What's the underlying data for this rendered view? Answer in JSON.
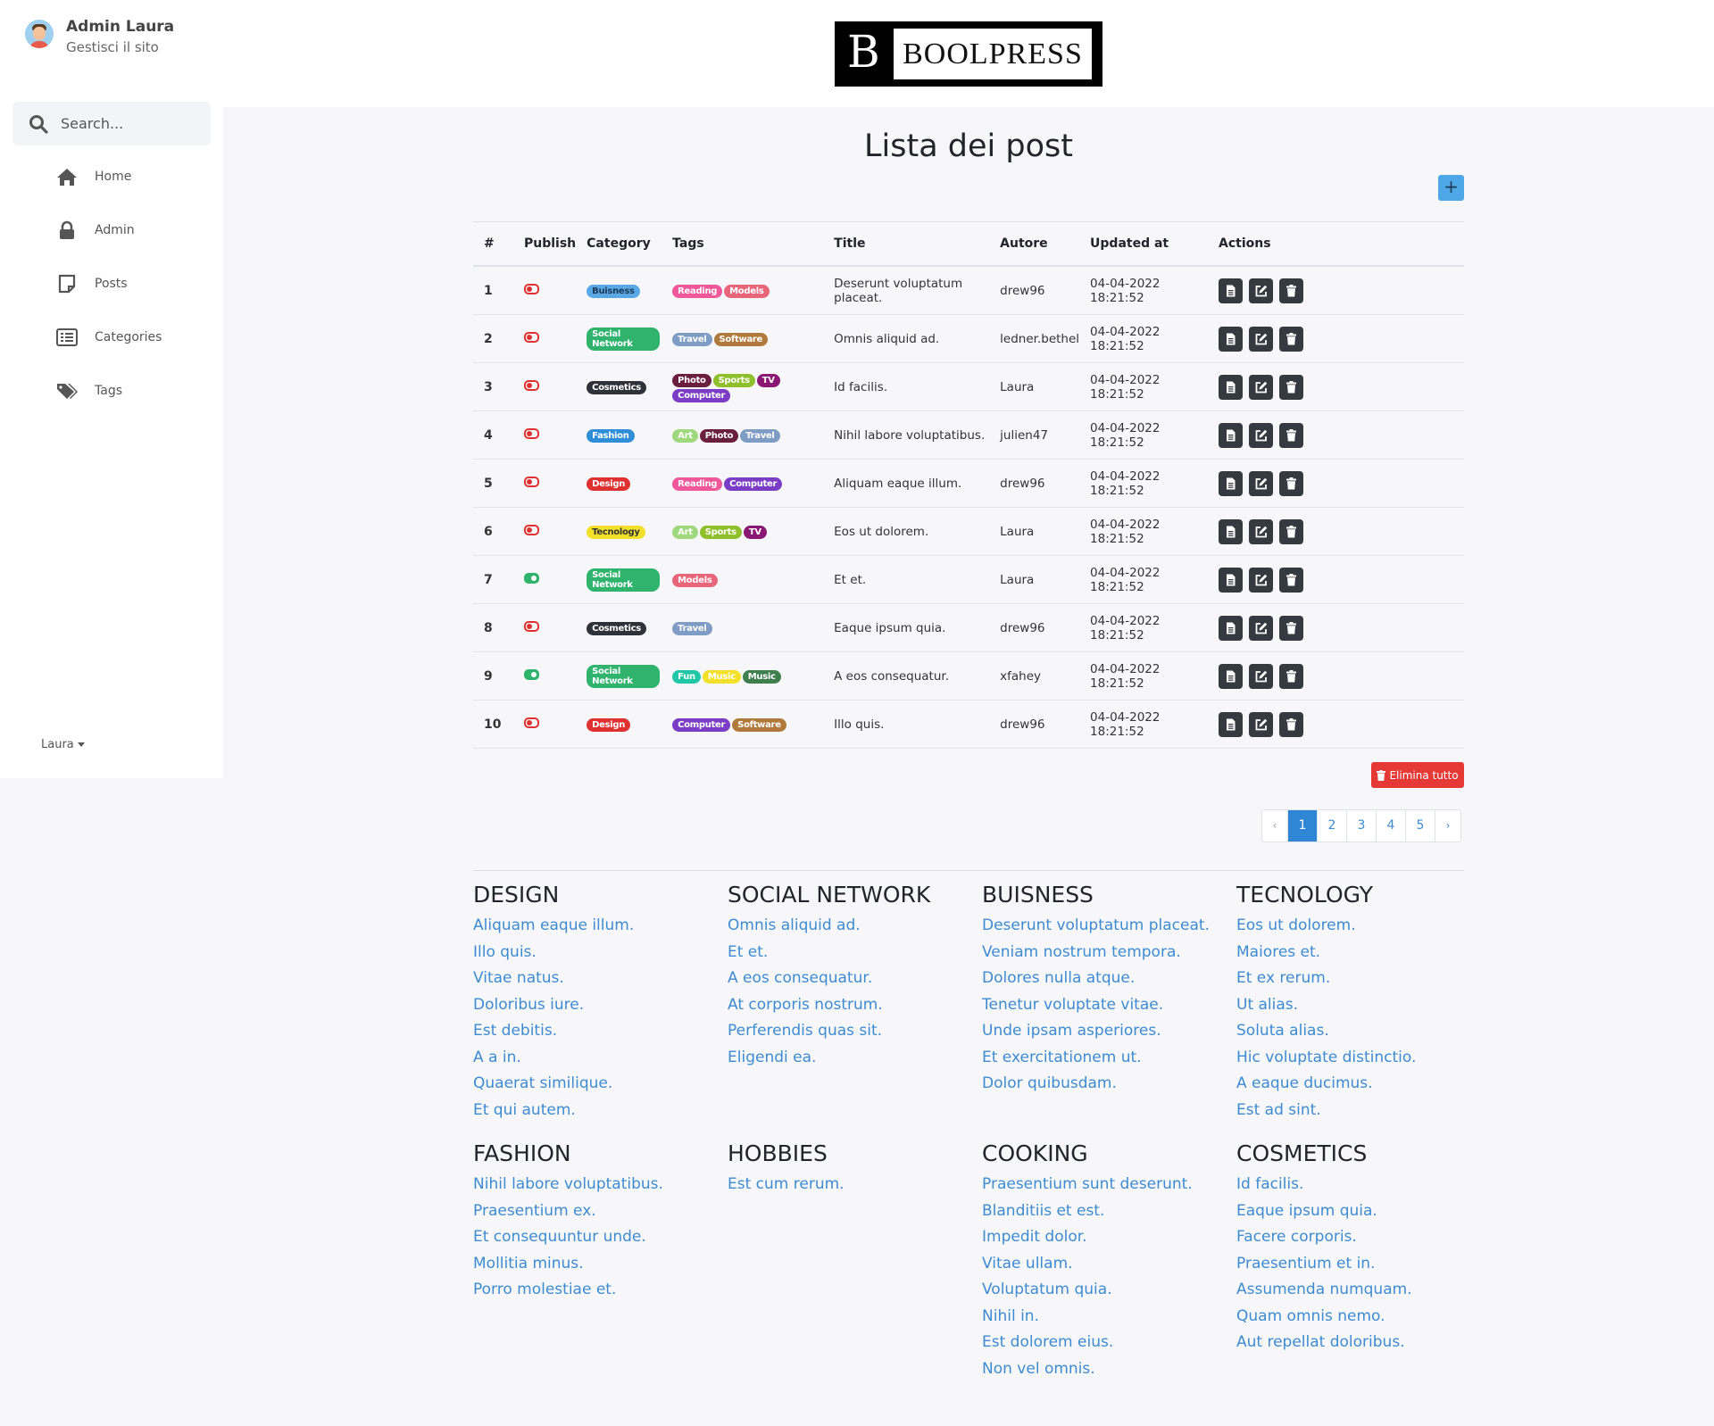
{
  "user": {
    "name": "Admin Laura",
    "subtitle": "Gestisci il sito"
  },
  "search": {
    "placeholder": "Search..."
  },
  "nav": [
    {
      "label": "Home",
      "icon": "home-icon"
    },
    {
      "label": "Admin",
      "icon": "lock-icon"
    },
    {
      "label": "Posts",
      "icon": "note-icon"
    },
    {
      "label": "Categories",
      "icon": "list-icon"
    },
    {
      "label": "Tags",
      "icon": "tags-icon"
    }
  ],
  "user_menu": "Laura",
  "brand": {
    "initial": "B",
    "name": "BOOLPRESS"
  },
  "page": {
    "title": "Lista dei post",
    "add_label": "+",
    "delete_all": "Elimina tutto"
  },
  "table": {
    "headers": [
      "#",
      "Publish",
      "Category",
      "Tags",
      "Title",
      "Autore",
      "Updated at",
      "Actions"
    ],
    "rows": [
      {
        "id": "1",
        "published": false,
        "category": {
          "label": "Buisness",
          "color": "#5aa9e6",
          "text": "#1d3a55"
        },
        "tags": [
          {
            "label": "Reading",
            "color": "#f0589b"
          },
          {
            "label": "Models",
            "color": "#e8667a"
          }
        ],
        "title": "Deserunt voluptatum placeat.",
        "author": "drew96",
        "updated": "04-04-2022 18:21:52"
      },
      {
        "id": "2",
        "published": false,
        "category": {
          "label": "Social Network",
          "color": "#2fb36d",
          "text": "#fff"
        },
        "tags": [
          {
            "label": "Travel",
            "color": "#7f9cc4"
          },
          {
            "label": "Software",
            "color": "#b07a3c"
          }
        ],
        "title": "Omnis aliquid ad.",
        "author": "ledner.bethel",
        "updated": "04-04-2022 18:21:52"
      },
      {
        "id": "3",
        "published": false,
        "category": {
          "label": "Cosmetics",
          "color": "#2f3238",
          "text": "#fff"
        },
        "tags": [
          {
            "label": "Photo",
            "color": "#6b1f3f"
          },
          {
            "label": "Sports",
            "color": "#8fbf2a"
          },
          {
            "label": "TV",
            "color": "#8b1774"
          },
          {
            "label": "Computer",
            "color": "#7b3cc6"
          }
        ],
        "title": "Id facilis.",
        "author": "Laura",
        "updated": "04-04-2022 18:21:52"
      },
      {
        "id": "4",
        "published": false,
        "category": {
          "label": "Fashion",
          "color": "#2e8ed8",
          "text": "#fff"
        },
        "tags": [
          {
            "label": "Art",
            "color": "#9fd87d"
          },
          {
            "label": "Photo",
            "color": "#6b1f3f"
          },
          {
            "label": "Travel",
            "color": "#7f9cc4"
          }
        ],
        "title": "Nihil labore voluptatibus.",
        "author": "julien47",
        "updated": "04-04-2022 18:21:52"
      },
      {
        "id": "5",
        "published": false,
        "category": {
          "label": "Design",
          "color": "#e03131",
          "text": "#fff"
        },
        "tags": [
          {
            "label": "Reading",
            "color": "#f0589b"
          },
          {
            "label": "Computer",
            "color": "#7b3cc6"
          }
        ],
        "title": "Aliquam eaque illum.",
        "author": "drew96",
        "updated": "04-04-2022 18:21:52"
      },
      {
        "id": "6",
        "published": false,
        "category": {
          "label": "Tecnology",
          "color": "#f2e02a",
          "text": "#333"
        },
        "tags": [
          {
            "label": "Art",
            "color": "#9fd87d"
          },
          {
            "label": "Sports",
            "color": "#8fbf2a"
          },
          {
            "label": "TV",
            "color": "#8b1774"
          }
        ],
        "title": "Eos ut dolorem.",
        "author": "Laura",
        "updated": "04-04-2022 18:21:52"
      },
      {
        "id": "7",
        "published": true,
        "category": {
          "label": "Social Network",
          "color": "#2fb36d",
          "text": "#fff"
        },
        "tags": [
          {
            "label": "Models",
            "color": "#e8667a"
          }
        ],
        "title": "Et et.",
        "author": "Laura",
        "updated": "04-04-2022 18:21:52"
      },
      {
        "id": "8",
        "published": false,
        "category": {
          "label": "Cosmetics",
          "color": "#2f3238",
          "text": "#fff"
        },
        "tags": [
          {
            "label": "Travel",
            "color": "#7f9cc4"
          }
        ],
        "title": "Eaque ipsum quia.",
        "author": "drew96",
        "updated": "04-04-2022 18:21:52"
      },
      {
        "id": "9",
        "published": true,
        "category": {
          "label": "Social Network",
          "color": "#2fb36d",
          "text": "#fff"
        },
        "tags": [
          {
            "label": "Fun",
            "color": "#1fc7a6"
          },
          {
            "label": "Music",
            "color": "#f2e02a"
          },
          {
            "label": "Music",
            "color": "#3f7f4e"
          }
        ],
        "title": "A eos consequatur.",
        "author": "xfahey",
        "updated": "04-04-2022 18:21:52"
      },
      {
        "id": "10",
        "published": false,
        "category": {
          "label": "Design",
          "color": "#e03131",
          "text": "#fff"
        },
        "tags": [
          {
            "label": "Computer",
            "color": "#7b3cc6"
          },
          {
            "label": "Software",
            "color": "#b07a3c"
          }
        ],
        "title": "Illo quis.",
        "author": "drew96",
        "updated": "04-04-2022 18:21:52"
      }
    ]
  },
  "pagination": {
    "prev": "‹",
    "pages": [
      "1",
      "2",
      "3",
      "4",
      "5"
    ],
    "active": "1",
    "next": "›"
  },
  "categories": [
    {
      "name": "DESIGN",
      "posts": [
        "Aliquam eaque illum.",
        "Illo quis.",
        "Vitae natus.",
        "Doloribus iure.",
        "Est debitis.",
        "A a in.",
        "Quaerat similique.",
        "Et qui autem."
      ]
    },
    {
      "name": "SOCIAL NETWORK",
      "posts": [
        "Omnis aliquid ad.",
        "Et et.",
        "A eos consequatur.",
        "At corporis nostrum.",
        "Perferendis quas sit.",
        "Eligendi ea."
      ]
    },
    {
      "name": "BUISNESS",
      "posts": [
        "Deserunt voluptatum placeat.",
        "Veniam nostrum tempora.",
        "Dolores nulla atque.",
        "Tenetur voluptate vitae.",
        "Unde ipsam asperiores.",
        "Et exercitationem ut.",
        "Dolor quibusdam."
      ]
    },
    {
      "name": "TECNOLOGY",
      "posts": [
        "Eos ut dolorem.",
        "Maiores et.",
        "Et ex rerum.",
        "Ut alias.",
        "Soluta alias.",
        "Hic voluptate distinctio.",
        "A eaque ducimus.",
        "Est ad sint."
      ]
    },
    {
      "name": "FASHION",
      "posts": [
        "Nihil labore voluptatibus.",
        "Praesentium ex.",
        "Et consequuntur unde.",
        "Mollitia minus.",
        "Porro molestiae et."
      ]
    },
    {
      "name": "HOBBIES",
      "posts": [
        "Est cum rerum."
      ]
    },
    {
      "name": "COOKING",
      "posts": [
        "Praesentium sunt deserunt.",
        "Blanditiis et est.",
        "Impedit dolor.",
        "Vitae ullam.",
        "Voluptatum quia.",
        "Nihil in.",
        "Est dolorem eius.",
        "Non vel omnis."
      ]
    },
    {
      "name": "COSMETICS",
      "posts": [
        "Id facilis.",
        "Eaque ipsum quia.",
        "Facere corporis.",
        "Praesentium et in.",
        "Assumenda numquam.",
        "Quam omnis nemo.",
        "Aut repellat doloribus."
      ]
    }
  ]
}
